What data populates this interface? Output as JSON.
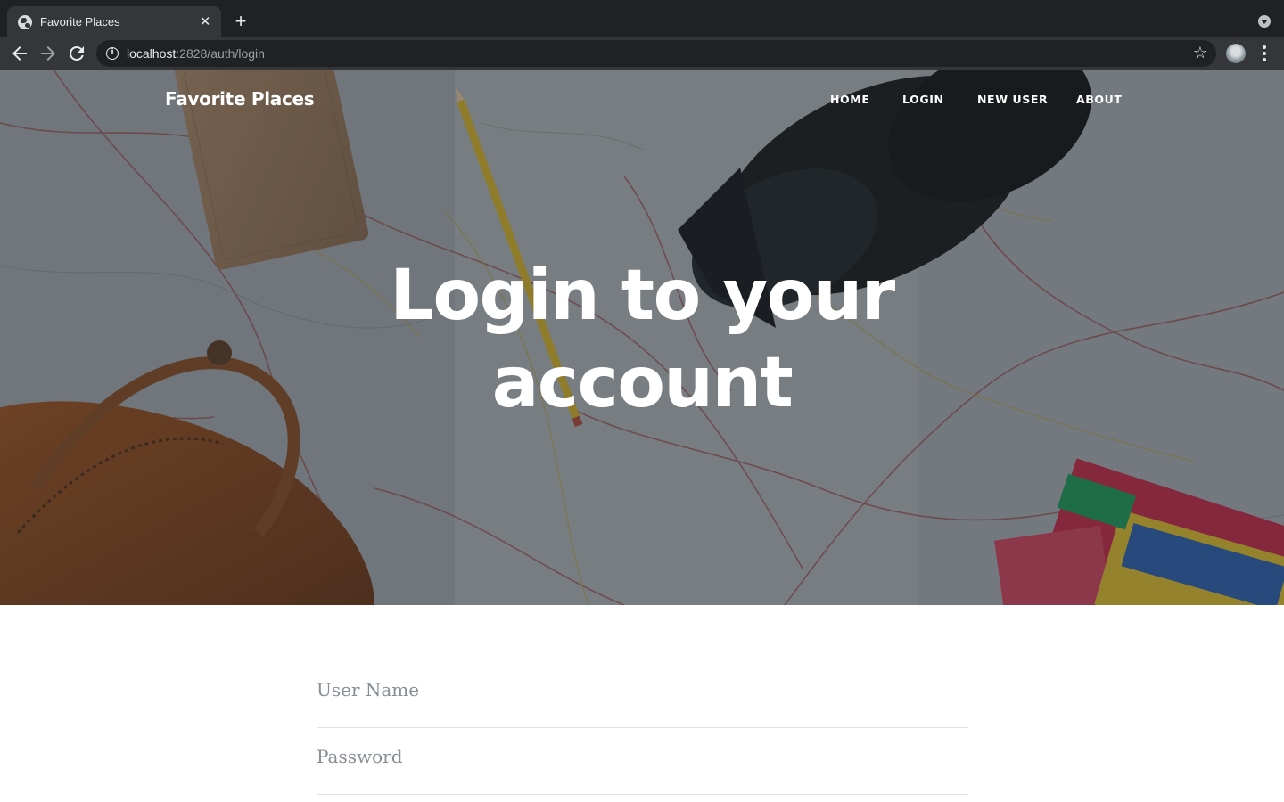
{
  "browser": {
    "tab_title": "Favorite Places",
    "tab_close_icon": "close-icon",
    "new_tab_icon": "plus-icon",
    "url_host": "localhost",
    "url_rest": ":2828/auth/login",
    "icons": [
      "back-arrow-icon",
      "forward-arrow-icon",
      "reload-icon",
      "info-icon",
      "star-icon",
      "profile-avatar",
      "more-vert-icon",
      "tab-search-icon"
    ]
  },
  "navbar": {
    "brand": "Favorite Places",
    "links": [
      "HOME",
      "LOGIN",
      "NEW USER",
      "ABOUT"
    ]
  },
  "hero": {
    "heading_line1": "Login to your",
    "heading_line2": "account"
  },
  "form": {
    "username_placeholder": "User Name",
    "password_placeholder": "Password"
  },
  "colors": {
    "chrome_dark": "#202124",
    "chrome_toolbar": "#35363a",
    "hero_text": "#ffffff",
    "placeholder": "#868e96",
    "field_border": "#dee2e6"
  }
}
